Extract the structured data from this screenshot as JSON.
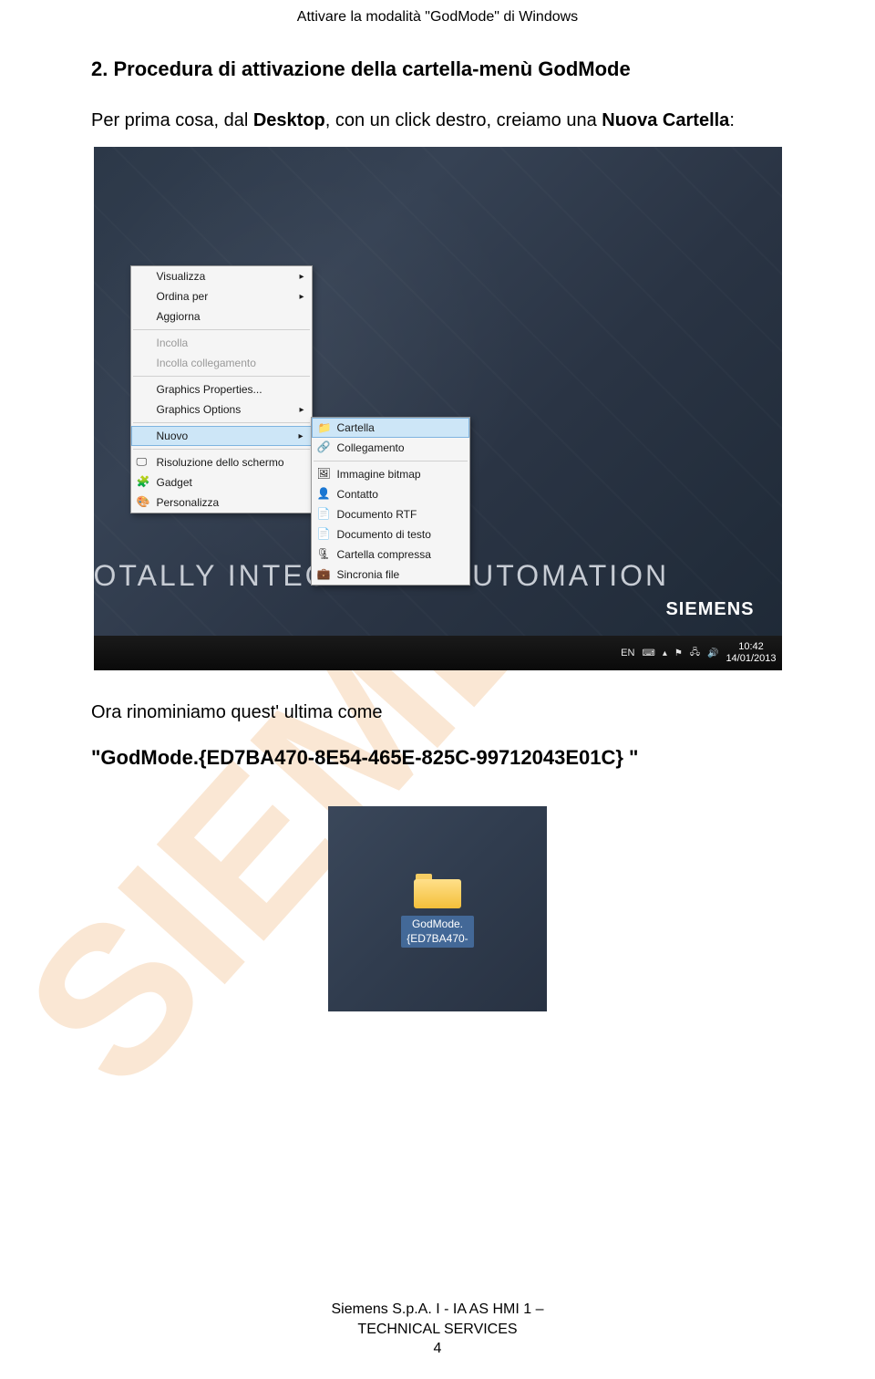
{
  "doc_header": "Attivare la modalità \"GodMode\" di Windows",
  "section": "2. Procedura di attivazione della cartella-menù GodMode",
  "para1_pre": "Per prima cosa, dal ",
  "para1_bold1": "Desktop",
  "para1_mid": ", con un click destro, creiamo una ",
  "para1_bold2": "Nuova Cartella",
  "para1_post": ":",
  "screenshot1": {
    "banner": "OTALLY INTEGRATED AUTOMATION",
    "brand": "SIEMENS",
    "context_menu": [
      {
        "label": "Visualizza",
        "arrow": true
      },
      {
        "label": "Ordina per",
        "arrow": true
      },
      {
        "label": "Aggiorna"
      },
      {
        "sep": true
      },
      {
        "label": "Incolla",
        "disabled": true
      },
      {
        "label": "Incolla collegamento",
        "disabled": true
      },
      {
        "sep": true
      },
      {
        "label": "Graphics Properties..."
      },
      {
        "label": "Graphics Options",
        "arrow": true
      },
      {
        "sep": true
      },
      {
        "label": "Nuovo",
        "arrow": true,
        "hover": true
      },
      {
        "sep": true
      },
      {
        "label": "Risoluzione dello schermo",
        "icon": "monitor"
      },
      {
        "label": "Gadget",
        "icon": "gadget"
      },
      {
        "label": "Personalizza",
        "icon": "paint"
      }
    ],
    "submenu": [
      {
        "label": "Cartella",
        "icon": "📁",
        "hover": true
      },
      {
        "label": "Collegamento",
        "icon": "🔗"
      },
      {
        "sep": true
      },
      {
        "label": "Immagine bitmap",
        "icon": "🖼"
      },
      {
        "label": "Contatto",
        "icon": "👤"
      },
      {
        "label": "Documento RTF",
        "icon": "📄"
      },
      {
        "label": "Documento di testo",
        "icon": "📄"
      },
      {
        "label": "Cartella compressa",
        "icon": "🗜"
      },
      {
        "label": "Sincronia file",
        "icon": "💼"
      }
    ],
    "taskbar": {
      "lang": "EN",
      "time": "10:42",
      "date": "14/01/2013"
    }
  },
  "para2": "Ora rinominiamo quest' ultima come",
  "code": "\"GodMode.{ED7BA470-8E54-465E-825C-99712043E01C} \"",
  "screenshot2": {
    "folder_label_line1": "GodMode.",
    "folder_label_line2": "{ED7BA470-"
  },
  "footer": {
    "line1": "Siemens S.p.A.  I - IA AS HMI 1 –",
    "line2": "TECHNICAL SERVICES",
    "page": "4"
  },
  "watermark_text": "SIEMENS"
}
